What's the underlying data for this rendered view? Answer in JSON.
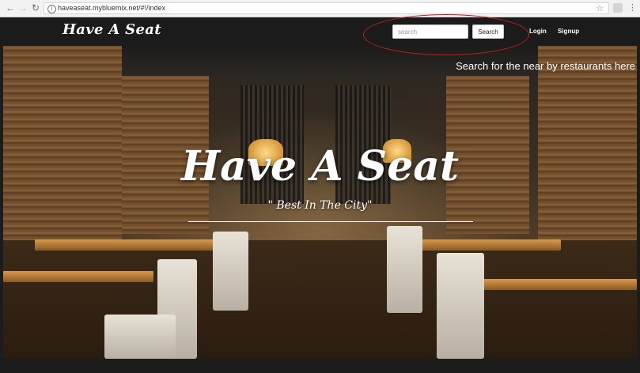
{
  "browser": {
    "url": "haveaseat.mybluemix.net/#!/index",
    "icons": [
      "back-arrow-icon",
      "forward-arrow-icon",
      "reload-icon",
      "info-icon",
      "star-icon",
      "menu-dots-icon"
    ]
  },
  "navbar": {
    "brand": "Have A Seat",
    "search_placeholder": "search",
    "search_button": "Search",
    "login": "Login",
    "signup": "Signup"
  },
  "annotation": {
    "caption": "Search for the near by restaurants here",
    "highlight_color": "#c0201c"
  },
  "hero": {
    "title": "Have A Seat",
    "subtitle": "\" Best In The City\""
  },
  "colors": {
    "navbar_bg": "#1b1b1b",
    "text": "#ffffff"
  }
}
